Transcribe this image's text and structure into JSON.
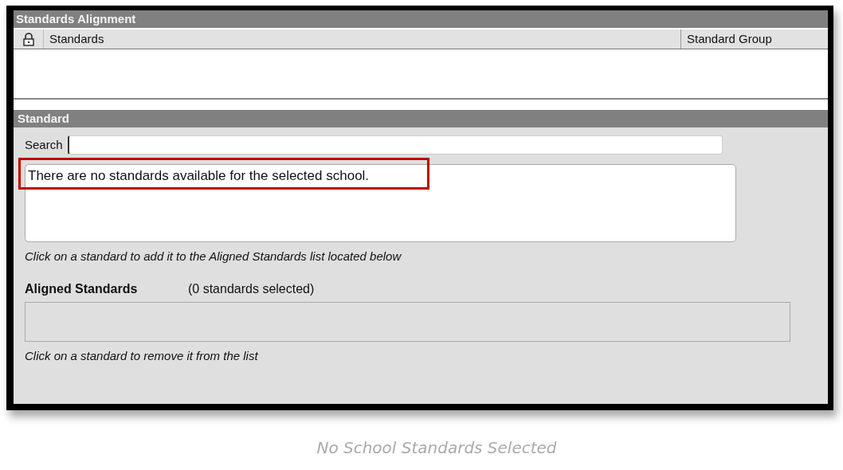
{
  "alignment": {
    "title": "Standards Alignment",
    "columns": [
      {
        "kind": "lock"
      },
      {
        "label": "Standards",
        "kind": "text"
      },
      {
        "label": "Standard Group",
        "kind": "text"
      }
    ]
  },
  "standard": {
    "title": "Standard",
    "search": {
      "label": "Search"
    },
    "message": {
      "text": "There are no standards available for the selected school.",
      "highlighted": true
    },
    "hint": "Click on a standard to add it to the Aligned Standards list located below",
    "aligned": {
      "label": "Aligned Standards",
      "count": "(0 standards selected)",
      "hint": "Click on a standard to remove it from the list"
    }
  },
  "caption": "No School Standards Selected"
}
